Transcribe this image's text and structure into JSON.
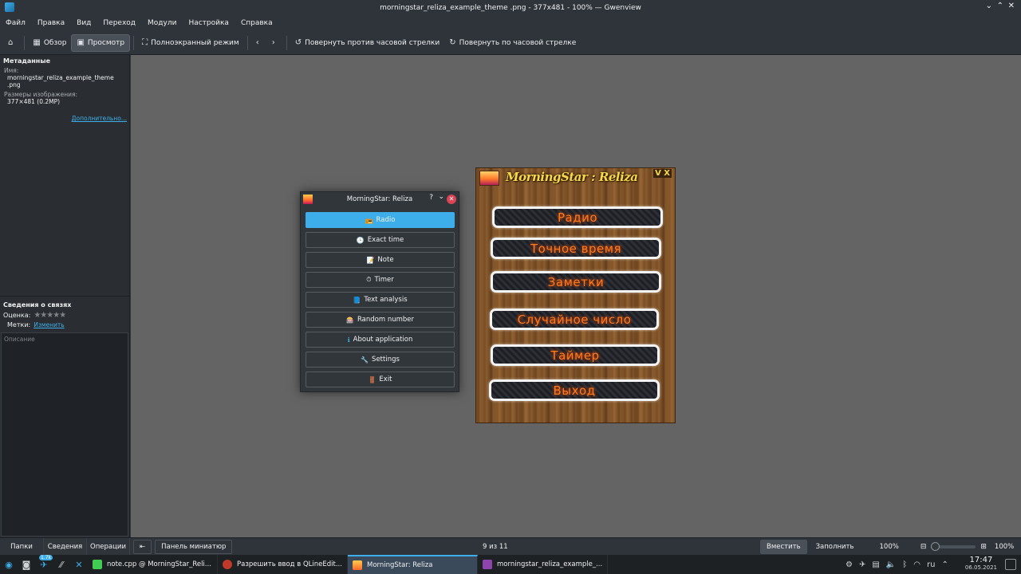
{
  "window": {
    "title": "morningstar_reliza_example_theme .png - 377x481 - 100% — Gwenview"
  },
  "menu": [
    "Файл",
    "Правка",
    "Вид",
    "Переход",
    "Модули",
    "Настройка",
    "Справка"
  ],
  "toolbar": {
    "overview": "Обзор",
    "view": "Просмотр",
    "fullscreen": "Полноэкранный режим",
    "rotate_left": "Повернуть против часовой стрелки",
    "rotate_right": "Повернуть по часовой стрелке"
  },
  "sidebar": {
    "metadata_title": "Метаданные",
    "name_label": "Имя:",
    "name_value": "morningstar_reliza_example_theme .png",
    "size_label": "Размеры изображения:",
    "size_value": "377×481 (0.2MP)",
    "more_link": "Дополнительно...",
    "relations_title": "Сведения о связях",
    "rating_label": "Оценка:",
    "tags_label": "Метки:",
    "tags_link": "Изменить",
    "description_placeholder": "Описание"
  },
  "dialog": {
    "title": "MorningStar: Reliza",
    "help": "?",
    "buttons": [
      {
        "label": "Radio",
        "icon": "📻"
      },
      {
        "label": "Exact time",
        "icon": "🕒"
      },
      {
        "label": "Note",
        "icon": "📝"
      },
      {
        "label": "Timer",
        "icon": "⏱"
      },
      {
        "label": "Text analysis",
        "icon": "📘"
      },
      {
        "label": "Random number",
        "icon": "🎰"
      },
      {
        "label": "About application",
        "icon": "ℹ"
      },
      {
        "label": "Settings",
        "icon": "🔧"
      },
      {
        "label": "Exit",
        "icon": "🚪"
      }
    ]
  },
  "image": {
    "title": "MorningStar : Reliza",
    "controls": "V X",
    "buttons": [
      "Радио",
      "Точное время",
      "Заметки",
      "Случайное число",
      "Таймер",
      "Выход"
    ]
  },
  "statusbar": {
    "tab_folders": "Папки",
    "tab_info": "Сведения",
    "tab_operations": "Операции",
    "thumbnails": "Панель миниатюр",
    "counter": "9 из 11",
    "fit": "Вместить",
    "fill": "Заполнить",
    "zoom_100": "100%",
    "zoom_value": "100%"
  },
  "taskbar": {
    "badge": "1.7k",
    "tasks": [
      {
        "label": "note.cpp @ MorningStar_Reli...",
        "color": "#41cd52"
      },
      {
        "label": "Разрешить ввод в QLineEdit...",
        "color": "#c0392b"
      },
      {
        "label": "MorningStar: Reliza",
        "color": "#ff8a2a"
      },
      {
        "label": "morningstar_reliza_example_...",
        "color": "#8e44ad"
      }
    ],
    "lang": "ru",
    "time": "17:47",
    "date": "06.05.2021"
  }
}
